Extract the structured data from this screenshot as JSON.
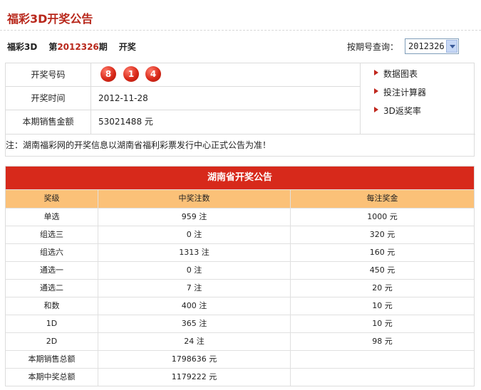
{
  "header": {
    "title": "福彩3D开奖公告"
  },
  "draw": {
    "game": "福彩3D",
    "prefix": "第",
    "issue": "2012326",
    "suffix": "期",
    "status": "开奖"
  },
  "search": {
    "label": "按期号查询：",
    "selected": "2012326"
  },
  "info": {
    "numbers_label": "开奖号码",
    "balls": [
      "8",
      "1",
      "4"
    ],
    "date_label": "开奖时间",
    "date": "2012-11-28",
    "sales_label": "本期销售金额",
    "sales": "53021488 元"
  },
  "links": [
    {
      "label": "数据图表"
    },
    {
      "label": "投注计算器"
    },
    {
      "label": "3D返奖率"
    }
  ],
  "notice": "注：湖南福彩网的开奖信息以湖南省福利彩票发行中心正式公告为准！",
  "results": {
    "title": "湖南省开奖公告",
    "columns": [
      "奖级",
      "中奖注数",
      "每注奖金"
    ],
    "rows": [
      {
        "level": "单选",
        "count": "959 注",
        "prize": "1000 元"
      },
      {
        "level": "组选三",
        "count": "0 注",
        "prize": "320 元"
      },
      {
        "level": "组选六",
        "count": "1313 注",
        "prize": "160 元"
      },
      {
        "level": "通选一",
        "count": "0 注",
        "prize": "450 元"
      },
      {
        "level": "通选二",
        "count": "7 注",
        "prize": "20 元"
      },
      {
        "level": "和数",
        "count": "400 注",
        "prize": "10 元"
      },
      {
        "level": "1D",
        "count": "365 注",
        "prize": "10 元"
      },
      {
        "level": "2D",
        "count": "24 注",
        "prize": "98 元"
      }
    ],
    "totals": [
      {
        "label": "本期销售总额",
        "value": "1798636 元"
      },
      {
        "label": "本期中奖总额",
        "value": "1179222 元"
      }
    ]
  },
  "colors": {
    "accent": "#b8271b",
    "table_header": "#d7291b",
    "column_header": "#fbc178"
  }
}
